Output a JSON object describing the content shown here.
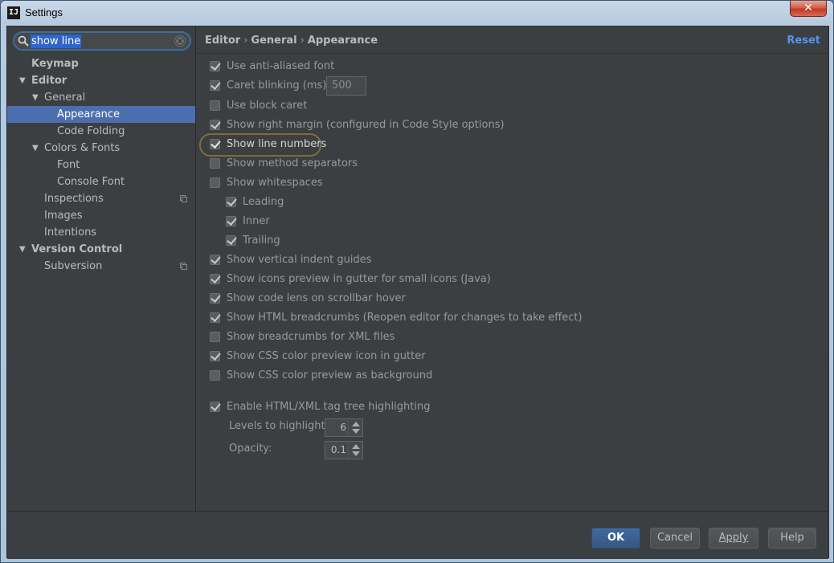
{
  "window": {
    "title": "Settings",
    "app_icon_text": "IJ"
  },
  "search": {
    "value": "show line"
  },
  "sidebar": {
    "items": [
      {
        "label": "Keymap",
        "level": 0,
        "bold": true,
        "expanded": null
      },
      {
        "label": "Editor",
        "level": 0,
        "bold": true,
        "expanded": true
      },
      {
        "label": "General",
        "level": 1,
        "bold": false,
        "expanded": true
      },
      {
        "label": "Appearance",
        "level": 2,
        "bold": false,
        "selected": true
      },
      {
        "label": "Code Folding",
        "level": 2,
        "bold": false
      },
      {
        "label": "Colors & Fonts",
        "level": 1,
        "bold": false,
        "expanded": true
      },
      {
        "label": "Font",
        "level": 2,
        "bold": false
      },
      {
        "label": "Console Font",
        "level": 2,
        "bold": false
      },
      {
        "label": "Inspections",
        "level": 1,
        "bold": false,
        "project_icon": true
      },
      {
        "label": "Images",
        "level": 1,
        "bold": false
      },
      {
        "label": "Intentions",
        "level": 1,
        "bold": false
      },
      {
        "label": "Version Control",
        "level": 0,
        "bold": true,
        "expanded": true
      },
      {
        "label": "Subversion",
        "level": 1,
        "bold": false,
        "project_icon": true
      }
    ]
  },
  "breadcrumb": {
    "items": [
      "Editor",
      "General",
      "Appearance"
    ],
    "separator": "›"
  },
  "reset_label": "Reset",
  "options": {
    "antialiased": {
      "label": "Use anti-aliased font",
      "checked": true
    },
    "caret_blinking": {
      "label": "Caret blinking (ms):",
      "checked": true,
      "value": "500"
    },
    "block_caret": {
      "label": "Use block caret",
      "checked": false
    },
    "right_margin": {
      "label": "Show right margin (configured in Code Style options)",
      "checked": true
    },
    "line_numbers": {
      "label": "Show line numbers",
      "checked": true
    },
    "method_separators": {
      "label": "Show method separators",
      "checked": false
    },
    "whitespaces": {
      "label": "Show whitespaces",
      "checked": false
    },
    "leading": {
      "label": "Leading",
      "checked": true
    },
    "inner": {
      "label": "Inner",
      "checked": true
    },
    "trailing": {
      "label": "Trailing",
      "checked": true
    },
    "indent_guides": {
      "label": "Show vertical indent guides",
      "checked": true
    },
    "icons_preview": {
      "label": "Show icons preview in gutter for small icons (Java)",
      "checked": true
    },
    "code_lens": {
      "label": "Show code lens on scrollbar hover",
      "checked": true
    },
    "html_breadcrumbs": {
      "label": "Show HTML breadcrumbs (Reopen editor for changes to take effect)",
      "checked": true
    },
    "xml_breadcrumbs": {
      "label": "Show breadcrumbs for XML files",
      "checked": false
    },
    "css_icon": {
      "label": "Show CSS color preview icon in gutter",
      "checked": true
    },
    "css_background": {
      "label": "Show CSS color preview as background",
      "checked": false
    },
    "tag_tree": {
      "label": "Enable HTML/XML tag tree highlighting",
      "checked": true
    }
  },
  "levels": {
    "label": "Levels to highlight:",
    "value": "6"
  },
  "opacity": {
    "label": "Opacity:",
    "value": "0.1"
  },
  "footer": {
    "ok": "OK",
    "cancel": "Cancel",
    "apply": "Apply",
    "help": "Help"
  },
  "colors": {
    "background": "#3c3f41",
    "selection": "#4b6eaf",
    "accent_link": "#5394ec",
    "highlight_ring": "#7f6b3e"
  }
}
